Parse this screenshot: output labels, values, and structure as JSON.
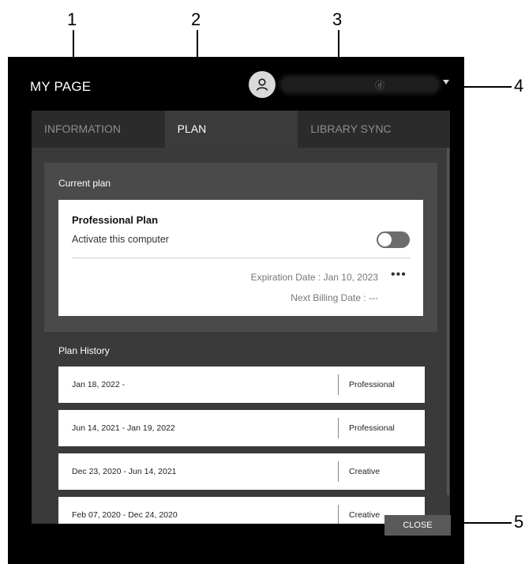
{
  "callouts": [
    "1",
    "2",
    "3",
    "4",
    "5"
  ],
  "window": {
    "title": "MY PAGE",
    "user_glyph": "ⓓ"
  },
  "tabs": [
    {
      "label": "INFORMATION",
      "active": false
    },
    {
      "label": "PLAN",
      "active": true
    },
    {
      "label": "LIBRARY SYNC",
      "active": false
    }
  ],
  "current_plan": {
    "section_title": "Current plan",
    "plan_name": "Professional Plan",
    "activate_label": "Activate this computer",
    "toggle_on": false,
    "expiration": "Expiration Date : Jan 10, 2023",
    "next_billing": "Next Billing Date : ---",
    "more_icon": "•••"
  },
  "plan_history": {
    "section_title": "Plan History",
    "rows": [
      {
        "date": "Jan 18, 2022 -",
        "plan": "Professional"
      },
      {
        "date": "Jun 14, 2021 - Jan 19, 2022",
        "plan": "Professional"
      },
      {
        "date": "Dec 23, 2020 - Jun 14, 2021",
        "plan": "Creative"
      },
      {
        "date": "Feb 07, 2020 - Dec 24, 2020",
        "plan": "Creative"
      }
    ]
  },
  "close_label": "CLOSE",
  "colors": {
    "window_bg": "#000000",
    "tab_bg": "#2b2b2b",
    "tab_active_bg": "#3b3b3b",
    "content_bg": "#3a3a3a",
    "panel_bg": "#4a4a4a",
    "close_bg": "#595959"
  }
}
